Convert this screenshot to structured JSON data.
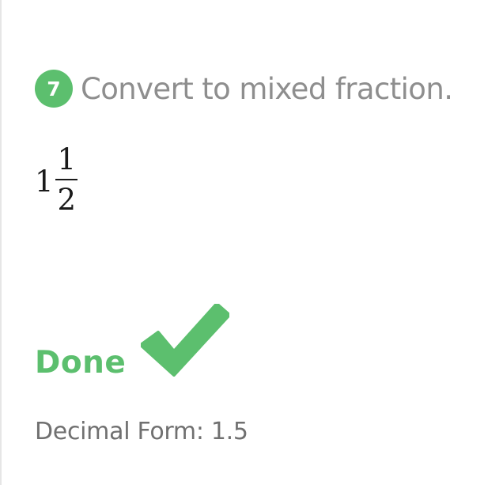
{
  "question": {
    "number": "7",
    "prompt": "Convert to mixed fraction."
  },
  "answer": {
    "whole": "1",
    "numerator": "1",
    "denominator": "2"
  },
  "status": {
    "label": "Done",
    "icon": "checkmark-icon"
  },
  "decimal": {
    "text": "Decimal Form: 1.5"
  },
  "colors": {
    "accent_green": "#5cbf6e",
    "prompt_gray": "#8e8e8e",
    "decimal_gray": "#707070"
  }
}
